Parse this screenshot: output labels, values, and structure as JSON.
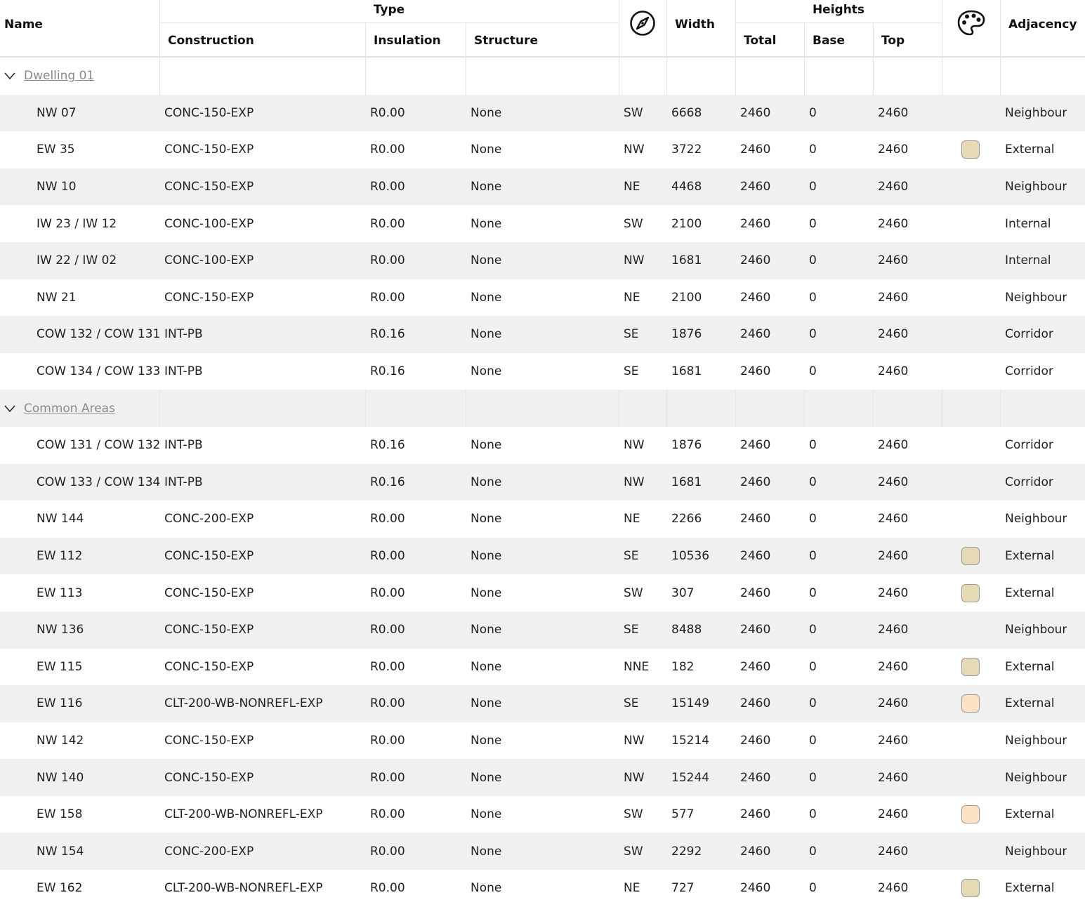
{
  "header": {
    "name": "Name",
    "type_group": "Type",
    "construction": "Construction",
    "insulation": "Insulation",
    "structure": "Structure",
    "orientation_icon": "compass-icon",
    "width": "Width",
    "heights_group": "Heights",
    "total": "Total",
    "base": "Base",
    "top": "Top",
    "color_icon": "palette-icon",
    "adjacency": "Adjacency"
  },
  "colors": {
    "swatch_tan": "#e6dab5",
    "swatch_peach": "#fde3c2",
    "row_alt": "#f0f0f0",
    "group_link": "#8a8a8a"
  },
  "rows": [
    {
      "kind": "group",
      "label": "Dwelling 01"
    },
    {
      "kind": "item",
      "name": "NW 07",
      "construction": "CONC-150-EXP",
      "insulation": "R0.00",
      "structure": "None",
      "orientation": "SW",
      "width": "6668",
      "total": "2460",
      "base": "0",
      "top": "2460",
      "swatch": "",
      "adjacency": "Neighbour"
    },
    {
      "kind": "item",
      "name": "EW 35",
      "construction": "CONC-150-EXP",
      "insulation": "R0.00",
      "structure": "None",
      "orientation": "NW",
      "width": "3722",
      "total": "2460",
      "base": "0",
      "top": "2460",
      "swatch": "#e6dab5",
      "adjacency": "External"
    },
    {
      "kind": "item",
      "name": "NW 10",
      "construction": "CONC-150-EXP",
      "insulation": "R0.00",
      "structure": "None",
      "orientation": "NE",
      "width": "4468",
      "total": "2460",
      "base": "0",
      "top": "2460",
      "swatch": "",
      "adjacency": "Neighbour"
    },
    {
      "kind": "item",
      "name": "IW 23 / IW 12",
      "construction": "CONC-100-EXP",
      "insulation": "R0.00",
      "structure": "None",
      "orientation": "SW",
      "width": "2100",
      "total": "2460",
      "base": "0",
      "top": "2460",
      "swatch": "",
      "adjacency": "Internal"
    },
    {
      "kind": "item",
      "name": "IW 22 / IW 02",
      "construction": "CONC-100-EXP",
      "insulation": "R0.00",
      "structure": "None",
      "orientation": "NW",
      "width": "1681",
      "total": "2460",
      "base": "0",
      "top": "2460",
      "swatch": "",
      "adjacency": "Internal"
    },
    {
      "kind": "item",
      "name": "NW 21",
      "construction": "CONC-150-EXP",
      "insulation": "R0.00",
      "structure": "None",
      "orientation": "NE",
      "width": "2100",
      "total": "2460",
      "base": "0",
      "top": "2460",
      "swatch": "",
      "adjacency": "Neighbour"
    },
    {
      "kind": "item",
      "name": "COW 132 / COW 131",
      "construction": "INT-PB",
      "insulation": "R0.16",
      "structure": "None",
      "orientation": "SE",
      "width": "1876",
      "total": "2460",
      "base": "0",
      "top": "2460",
      "swatch": "",
      "adjacency": "Corridor"
    },
    {
      "kind": "item",
      "name": "COW 134 / COW 133",
      "construction": "INT-PB",
      "insulation": "R0.16",
      "structure": "None",
      "orientation": "SE",
      "width": "1681",
      "total": "2460",
      "base": "0",
      "top": "2460",
      "swatch": "",
      "adjacency": "Corridor"
    },
    {
      "kind": "group",
      "label": "Common Areas"
    },
    {
      "kind": "item",
      "name": "COW 131 / COW 132",
      "construction": "INT-PB",
      "insulation": "R0.16",
      "structure": "None",
      "orientation": "NW",
      "width": "1876",
      "total": "2460",
      "base": "0",
      "top": "2460",
      "swatch": "",
      "adjacency": "Corridor"
    },
    {
      "kind": "item",
      "name": "COW 133 / COW 134",
      "construction": "INT-PB",
      "insulation": "R0.16",
      "structure": "None",
      "orientation": "NW",
      "width": "1681",
      "total": "2460",
      "base": "0",
      "top": "2460",
      "swatch": "",
      "adjacency": "Corridor"
    },
    {
      "kind": "item",
      "name": "NW 144",
      "construction": "CONC-200-EXP",
      "insulation": "R0.00",
      "structure": "None",
      "orientation": "NE",
      "width": "2266",
      "total": "2460",
      "base": "0",
      "top": "2460",
      "swatch": "",
      "adjacency": "Neighbour"
    },
    {
      "kind": "item",
      "name": "EW 112",
      "construction": "CONC-150-EXP",
      "insulation": "R0.00",
      "structure": "None",
      "orientation": "SE",
      "width": "10536",
      "total": "2460",
      "base": "0",
      "top": "2460",
      "swatch": "#e6dab5",
      "adjacency": "External"
    },
    {
      "kind": "item",
      "name": "EW 113",
      "construction": "CONC-150-EXP",
      "insulation": "R0.00",
      "structure": "None",
      "orientation": "SW",
      "width": "307",
      "total": "2460",
      "base": "0",
      "top": "2460",
      "swatch": "#e6dab5",
      "adjacency": "External"
    },
    {
      "kind": "item",
      "name": "NW 136",
      "construction": "CONC-150-EXP",
      "insulation": "R0.00",
      "structure": "None",
      "orientation": "SE",
      "width": "8488",
      "total": "2460",
      "base": "0",
      "top": "2460",
      "swatch": "",
      "adjacency": "Neighbour"
    },
    {
      "kind": "item",
      "name": "EW 115",
      "construction": "CONC-150-EXP",
      "insulation": "R0.00",
      "structure": "None",
      "orientation": "NNE",
      "width": "182",
      "total": "2460",
      "base": "0",
      "top": "2460",
      "swatch": "#e6dab5",
      "adjacency": "External"
    },
    {
      "kind": "item",
      "name": "EW 116",
      "construction": "CLT-200-WB-NONREFL-EXP",
      "insulation": "R0.00",
      "structure": "None",
      "orientation": "SE",
      "width": "15149",
      "total": "2460",
      "base": "0",
      "top": "2460",
      "swatch": "#fde3c2",
      "adjacency": "External"
    },
    {
      "kind": "item",
      "name": "NW 142",
      "construction": "CONC-150-EXP",
      "insulation": "R0.00",
      "structure": "None",
      "orientation": "NW",
      "width": "15214",
      "total": "2460",
      "base": "0",
      "top": "2460",
      "swatch": "",
      "adjacency": "Neighbour"
    },
    {
      "kind": "item",
      "name": "NW 140",
      "construction": "CONC-150-EXP",
      "insulation": "R0.00",
      "structure": "None",
      "orientation": "NW",
      "width": "15244",
      "total": "2460",
      "base": "0",
      "top": "2460",
      "swatch": "",
      "adjacency": "Neighbour"
    },
    {
      "kind": "item",
      "name": "EW 158",
      "construction": "CLT-200-WB-NONREFL-EXP",
      "insulation": "R0.00",
      "structure": "None",
      "orientation": "SW",
      "width": "577",
      "total": "2460",
      "base": "0",
      "top": "2460",
      "swatch": "#fde3c2",
      "adjacency": "External"
    },
    {
      "kind": "item",
      "name": "NW 154",
      "construction": "CONC-200-EXP",
      "insulation": "R0.00",
      "structure": "None",
      "orientation": "SW",
      "width": "2292",
      "total": "2460",
      "base": "0",
      "top": "2460",
      "swatch": "",
      "adjacency": "Neighbour"
    },
    {
      "kind": "item",
      "name": "EW 162",
      "construction": "CLT-200-WB-NONREFL-EXP",
      "insulation": "R0.00",
      "structure": "None",
      "orientation": "NE",
      "width": "727",
      "total": "2460",
      "base": "0",
      "top": "2460",
      "swatch": "#e6dab5",
      "adjacency": "External"
    }
  ]
}
